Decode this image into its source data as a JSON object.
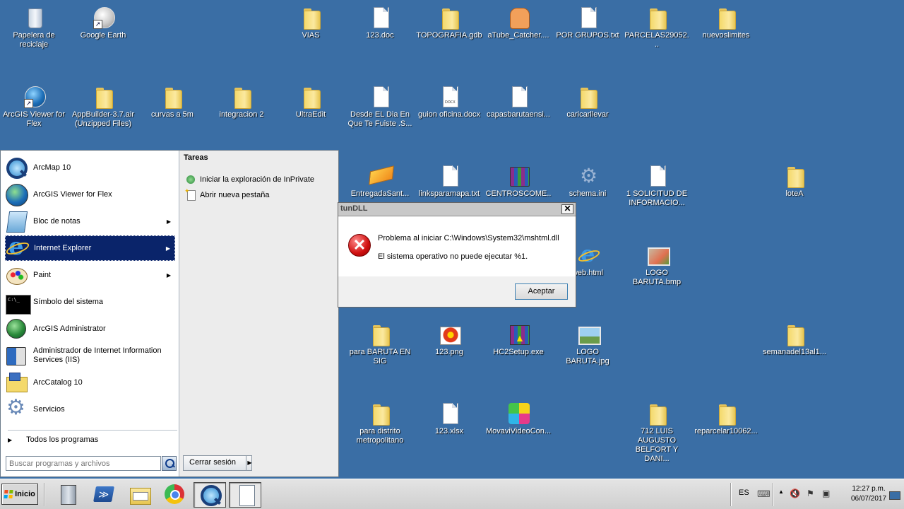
{
  "desktop": {
    "icons": [
      {
        "label": "Papelera de reciclaje",
        "type": "recycle-bin-icon"
      },
      {
        "label": "Google Earth",
        "type": "google-earth-icon"
      },
      {
        "label": "VIAS",
        "type": "folder-icon"
      },
      {
        "label": "123.doc",
        "type": "document-icon"
      },
      {
        "label": "TOPOGRAFIA.gdb",
        "type": "folder-icon"
      },
      {
        "label": "aTube_Catcher....",
        "type": "atube-icon"
      },
      {
        "label": "POR GRUPOS.txt",
        "type": "text-file-icon"
      },
      {
        "label": "PARCELAS29052...",
        "type": "folder-icon"
      },
      {
        "label": "nuevoslimites",
        "type": "folder-icon"
      },
      {
        "label": "ArcGIS Viewer for Flex",
        "type": "arcgis-viewer-icon"
      },
      {
        "label": "AppBuilder-3.7.air (Unzipped Files)",
        "type": "folder-icon"
      },
      {
        "label": "curvas a 5m",
        "type": "folder-icon"
      },
      {
        "label": "integracion 2",
        "type": "folder-icon"
      },
      {
        "label": "UltraEdit",
        "type": "folder-icon"
      },
      {
        "label": "Desde EL Dia En Que Te Fuiste .S...",
        "type": "document-icon"
      },
      {
        "label": "guion oficina.docx",
        "type": "docx-icon"
      },
      {
        "label": "capasbarutaensi...",
        "type": "document-icon"
      },
      {
        "label": "caricarllevar",
        "type": "folder-icon"
      },
      {
        "label": "EntregadaSant...",
        "type": "kml-icon"
      },
      {
        "label": "linksparamapa.txt",
        "type": "text-file-icon"
      },
      {
        "label": "CENTROSCOME...",
        "type": "rar-icon"
      },
      {
        "label": "schema.ini",
        "type": "settings-file-icon"
      },
      {
        "label": "1 SOLICITUD DE INFORMACIO...",
        "type": "document-icon"
      },
      {
        "label": "loteA",
        "type": "folder-icon"
      },
      {
        "label": "web.html",
        "type": "ie-html-icon"
      },
      {
        "label": "LOGO BARUTA.bmp",
        "type": "bitmap-icon"
      },
      {
        "label": "para BARUTA EN SIG",
        "type": "folder-icon"
      },
      {
        "label": "123.png",
        "type": "png-icon"
      },
      {
        "label": "HC2Setup.exe",
        "type": "installer-icon"
      },
      {
        "label": "LOGO BARUTA.jpg",
        "type": "jpg-icon"
      },
      {
        "label": "semanadel13al1...",
        "type": "folder-icon"
      },
      {
        "label": "para distrito metropolitano",
        "type": "folder-icon"
      },
      {
        "label": "123.xlsx",
        "type": "document-icon"
      },
      {
        "label": "MovaviVideoCon...",
        "type": "movavi-icon"
      },
      {
        "label": "712 LUIS AUGUSTO BELFORT Y DANI...",
        "type": "folder-icon"
      },
      {
        "label": "reparcelar10062...",
        "type": "folder-icon"
      }
    ],
    "partial_label": "."
  },
  "start_menu": {
    "programs": [
      {
        "label": "ArcMap 10",
        "icon": "arcmap-icon",
        "submenu": false
      },
      {
        "label": "ArcGIS Viewer for Flex",
        "icon": "arcgis-globe-icon",
        "submenu": false
      },
      {
        "label": "Bloc de notas",
        "icon": "notepad-icon",
        "submenu": true
      },
      {
        "label": "Internet Explorer",
        "icon": "internet-explorer-icon",
        "submenu": true,
        "active": true
      },
      {
        "label": "Paint",
        "icon": "paint-icon",
        "submenu": true
      },
      {
        "label": "Símbolo del sistema",
        "icon": "command-prompt-icon",
        "submenu": false
      },
      {
        "label": "ArcGIS Administrator",
        "icon": "arcgis-admin-icon",
        "submenu": false
      },
      {
        "label": "Administrador de Internet Information Services (IIS)",
        "icon": "iis-manager-icon",
        "submenu": false
      },
      {
        "label": "ArcCatalog 10",
        "icon": "arccatalog-icon",
        "submenu": false
      },
      {
        "label": "Servicios",
        "icon": "services-gear-icon",
        "submenu": false
      }
    ],
    "all_programs": "Todos los programas",
    "search_placeholder": "Buscar programas y archivos",
    "tasks_title": "Tareas",
    "tasks": [
      {
        "label": "Iniciar la exploración de InPrivate",
        "icon": "inprivate-icon"
      },
      {
        "label": "Abrir nueva pestaña",
        "icon": "new-tab-icon"
      }
    ],
    "logoff": "Cerrar sesión",
    "logoff_arrow": "▶",
    "submenu_arrow": "▶"
  },
  "dialog": {
    "title": "RunDLL",
    "title_visible": "tunDLL",
    "close_glyph": "✕",
    "error_glyph": "✕",
    "message1": "Problema al iniciar C:\\Windows\\System32\\mshtml.dll",
    "message2": "El sistema operativo no puede ejecutar %1.",
    "ok": "Aceptar"
  },
  "taskbar": {
    "start_label": "Inicio",
    "apps": [
      "server-manager-icon",
      "powershell-icon",
      "windows-explorer-icon",
      "chrome-icon",
      "arcmap-icon",
      "notepad-document-icon"
    ],
    "language": "ES",
    "time": "12:27 p.m.",
    "date": "06/07/2017",
    "tray_up": "▲",
    "colors": {
      "flag_red": "#f25022",
      "flag_green": "#7fba00",
      "flag_blue": "#00a4ef",
      "flag_yellow": "#ffb900"
    }
  }
}
